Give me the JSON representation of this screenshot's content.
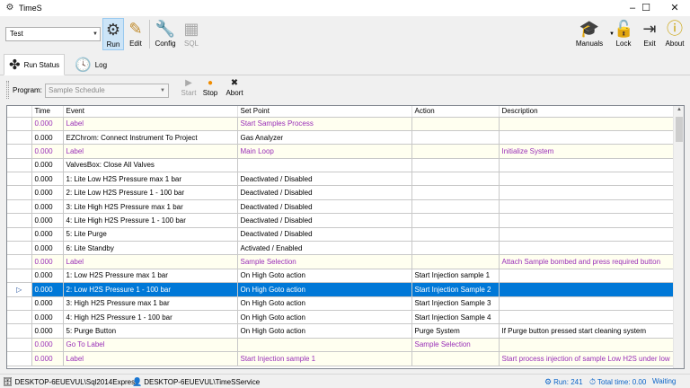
{
  "window": {
    "title": "TimeS",
    "minimize": "–",
    "maximize": "☐",
    "close": "✕"
  },
  "toolbar": {
    "profile_value": "Test",
    "run_label": "Run",
    "edit_label": "Edit",
    "config_label": "Config",
    "sql_label": "SQL",
    "manuals_label": "Manuals",
    "lock_label": "Lock",
    "exit_label": "Exit",
    "about_label": "About"
  },
  "tabs": [
    {
      "label": "Run Status"
    },
    {
      "label": "Log"
    }
  ],
  "program": {
    "label": "Program:",
    "value": "Sample Schedule",
    "start_label": "Start",
    "stop_label": "Stop",
    "abort_label": "Abort"
  },
  "grid": {
    "columns": [
      "Time",
      "Event",
      "Set Point",
      "Action",
      "Description"
    ],
    "rows": [
      {
        "time": "0.000",
        "event": "Label",
        "setpoint": "Start Samples Process",
        "action": "",
        "description": "",
        "kind": "label"
      },
      {
        "time": "0.000",
        "event": "EZChrom: Connect Instrument To Project",
        "setpoint": "Gas Analyzer",
        "action": "",
        "description": "",
        "kind": "normal"
      },
      {
        "time": "0.000",
        "event": "Label",
        "setpoint": "Main Loop",
        "action": "",
        "description": "Initialize System",
        "kind": "label"
      },
      {
        "time": "0.000",
        "event": "ValvesBox: Close All Valves",
        "setpoint": "",
        "action": "",
        "description": "",
        "kind": "normal"
      },
      {
        "time": "0.000",
        "event": "1: Lite Low H2S Pressure max 1 bar",
        "setpoint": "Deactivated / Disabled",
        "action": "",
        "description": "",
        "kind": "normal"
      },
      {
        "time": "0.000",
        "event": "2: Lite Low H2S Pressure 1 - 100 bar",
        "setpoint": "Deactivated / Disabled",
        "action": "",
        "description": "",
        "kind": "normal"
      },
      {
        "time": "0.000",
        "event": "3: Lite High H2S Pressure max 1 bar",
        "setpoint": "Deactivated / Disabled",
        "action": "",
        "description": "",
        "kind": "normal"
      },
      {
        "time": "0.000",
        "event": "4: Lite High H2S Pressure 1 - 100 bar",
        "setpoint": "Deactivated / Disabled",
        "action": "",
        "description": "",
        "kind": "normal"
      },
      {
        "time": "0.000",
        "event": "5: Lite Purge",
        "setpoint": "Deactivated / Disabled",
        "action": "",
        "description": "",
        "kind": "normal"
      },
      {
        "time": "0.000",
        "event": "6: Lite Standby",
        "setpoint": "Activated / Enabled",
        "action": "",
        "description": "",
        "kind": "normal"
      },
      {
        "time": "0.000",
        "event": "Label",
        "setpoint": "Sample Selection",
        "action": "",
        "description": "Attach Sample bombed and press required button",
        "kind": "label"
      },
      {
        "time": "0.000",
        "event": "1: Low H2S Pressure max 1 bar",
        "setpoint": "On High Goto action",
        "action": "Start Injection sample 1",
        "description": "",
        "kind": "normal"
      },
      {
        "time": "0.000",
        "event": "2: Low H2S Pressure 1 - 100 bar",
        "setpoint": "On High Goto action",
        "action": "Start Injection Sample 2",
        "description": "",
        "kind": "selected"
      },
      {
        "time": "0.000",
        "event": "3: High H2S Pressure max 1 bar",
        "setpoint": "On High Goto action",
        "action": "Start Injection Sample 3",
        "description": "",
        "kind": "normal"
      },
      {
        "time": "0.000",
        "event": "4: High H2S Pressure 1 - 100 bar",
        "setpoint": "On High Goto action",
        "action": "Start Injection Sample 4",
        "description": "",
        "kind": "normal"
      },
      {
        "time": "0.000",
        "event": "5: Purge Button",
        "setpoint": "On High Goto action",
        "action": "Purge System",
        "description": "If Purge button pressed start cleaning system",
        "kind": "normal"
      },
      {
        "time": "0.000",
        "event": "Go To Label",
        "setpoint": "",
        "action": "Sample Selection",
        "description": "",
        "kind": "label"
      },
      {
        "time": "0.000",
        "event": "Label",
        "setpoint": "Start Injection sample 1",
        "action": "",
        "description": "Start process injection of sample Low H2S under low",
        "kind": "label"
      }
    ],
    "selected_marker": "▷"
  },
  "statusbar": {
    "db_connection": "DESKTOP-6EUEVUL\\Sql2014Express",
    "service": "DESKTOP-6EUEVUL\\TimeSService",
    "run": "Run: 241",
    "total_time": "Total time: 0.00",
    "state": "Waiting"
  },
  "colors": {
    "selection": "#0078d7",
    "label_text": "#9a30b8",
    "label_background": "#fffff0"
  }
}
